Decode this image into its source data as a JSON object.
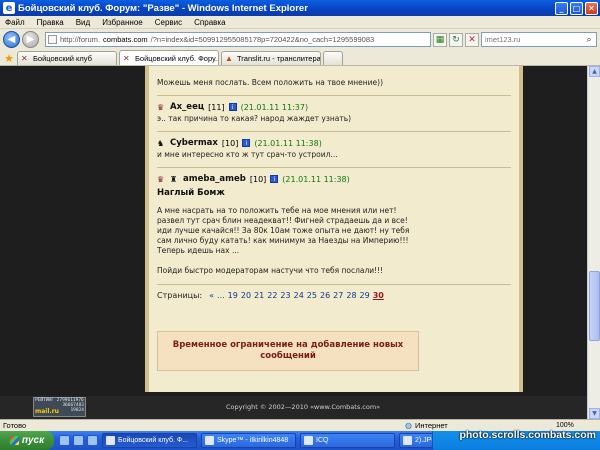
{
  "window": {
    "title": "Бойцовский клуб. Форум: \"Разве\" - Windows Internet Explorer"
  },
  "menu": [
    "Файл",
    "Правка",
    "Вид",
    "Избранное",
    "Сервис",
    "Справка"
  ],
  "address": {
    "prefix": "http://forum.",
    "host": "combats.com",
    "rest": "/?n=index&id=509912955085178p=720422&no_cach=1295599083"
  },
  "search": {
    "value": "imet123.ru"
  },
  "tabs": [
    {
      "label": "Бойцовский клуб"
    },
    {
      "label": "Бойцовский клуб. Фору...",
      "active": true
    },
    {
      "label": "Translit.ru - транслитераци..."
    }
  ],
  "posts": [
    {
      "body": "Можешь меня послать. Всем положить на твое мнение))"
    },
    {
      "nick": "Ах_еец",
      "level": "[11]",
      "date": "21.01.11 11:37",
      "body": "э.. так причина то какая? народ жаждет узнать)"
    },
    {
      "nick": "Cybermax",
      "level": "[10]",
      "date": "21.01.11 11:38",
      "body": "и мне интересно кто ж тут срач-то устроил..."
    },
    {
      "nick": "ameba_ameb",
      "level": "[10]",
      "date": "21.01.11 11:38",
      "subject": "Наглый Бомж",
      "lines": [
        "А мне насрать на то положить тебе на мое мнения или нет!",
        "развел тут срач блин неадекват!! Фигней страдаешь да и все!",
        "иди лучше качайся!! За 80к 10ам тоже опыта не дают! ну тебя",
        "сам лично буду катать! как минимум за Наезды на Империю!!!",
        "Теперь идешь нах ...",
        "",
        "Пойди быстро модераторам настучи что тебя послали!!!"
      ]
    }
  ],
  "pagination": {
    "label": "Страницы:",
    "prev": "«",
    "ellipsis": "...",
    "pages": [
      "19",
      "20",
      "21",
      "22",
      "23",
      "24",
      "25",
      "26",
      "27",
      "28",
      "29"
    ],
    "current": "30"
  },
  "notice": "Временное ограничение на добавление новых сообщений",
  "counter": {
    "line1": "РЕЙТИНГ 2799611976",
    "line2": "36667483",
    "line3": "19824",
    "brand": "mail.ru"
  },
  "copyright": "Copyright © 2002—2010 «www.Combats.com»",
  "status": {
    "left": "Готово",
    "zone": "Интернет",
    "zoom": "100%"
  },
  "taskbar": {
    "start": "пуск",
    "items": [
      {
        "label": "Бойцовский клуб. Ф...",
        "active": true
      },
      {
        "label": "Skype™ - iIkirilkin4848"
      },
      {
        "label": "ICQ"
      },
      {
        "label": "2).JPG - Paint"
      }
    ]
  },
  "watermark": "photo.scrolls.combats.com"
}
